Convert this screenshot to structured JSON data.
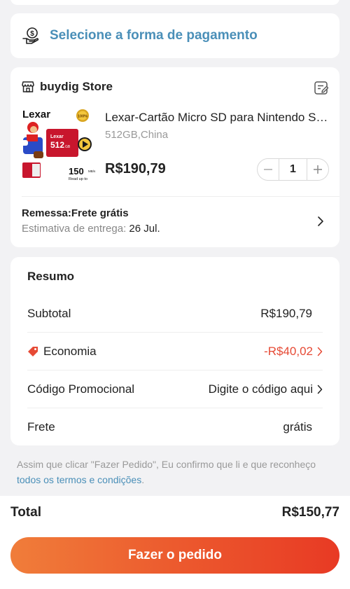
{
  "payment": {
    "label": "Selecione a forma de pagamento",
    "icon": "hand-coin-icon"
  },
  "store": {
    "name": "buydig Store",
    "store_icon": "storefront-icon",
    "note_icon": "edit-note-icon",
    "product": {
      "title": "Lexar-Cartão Micro SD para Nintendo Switch",
      "variant": "512GB,China",
      "price": "R$190,79",
      "quantity": "1",
      "image": {
        "brand": "Lexar",
        "capacity": "512",
        "capacity_unit": "GB",
        "speed": "150",
        "speed_unit": "MB/s",
        "speed_caption": "Read up to",
        "badge": "100%"
      }
    },
    "shipping": {
      "title": "Remessa:Frete grátis",
      "estimate_label": "Estimativa de entrega:",
      "estimate_date": "26 Jul."
    }
  },
  "summary": {
    "title": "Resumo",
    "subtotal_label": "Subtotal",
    "subtotal_value": "R$190,79",
    "savings_label": "Economia",
    "savings_value": "-R$40,02",
    "promo_label": "Código Promocional",
    "promo_value": "Digite o código aqui",
    "shipping_label": "Frete",
    "shipping_value": "grátis"
  },
  "terms": {
    "text": "Assim que clicar \"Fazer Pedido\", Eu confirmo que li e que reconheço ",
    "link": "todos os termos e condições",
    "end": "."
  },
  "footer": {
    "total_label": "Total",
    "total_value": "R$150,77",
    "order_button": "Fazer o pedido"
  },
  "colors": {
    "accent_blue": "#4a8fb8",
    "discount_red": "#e64a35",
    "button_gradient_start": "#f07d3a",
    "button_gradient_end": "#e83a24",
    "background": "#f2f2f4"
  }
}
